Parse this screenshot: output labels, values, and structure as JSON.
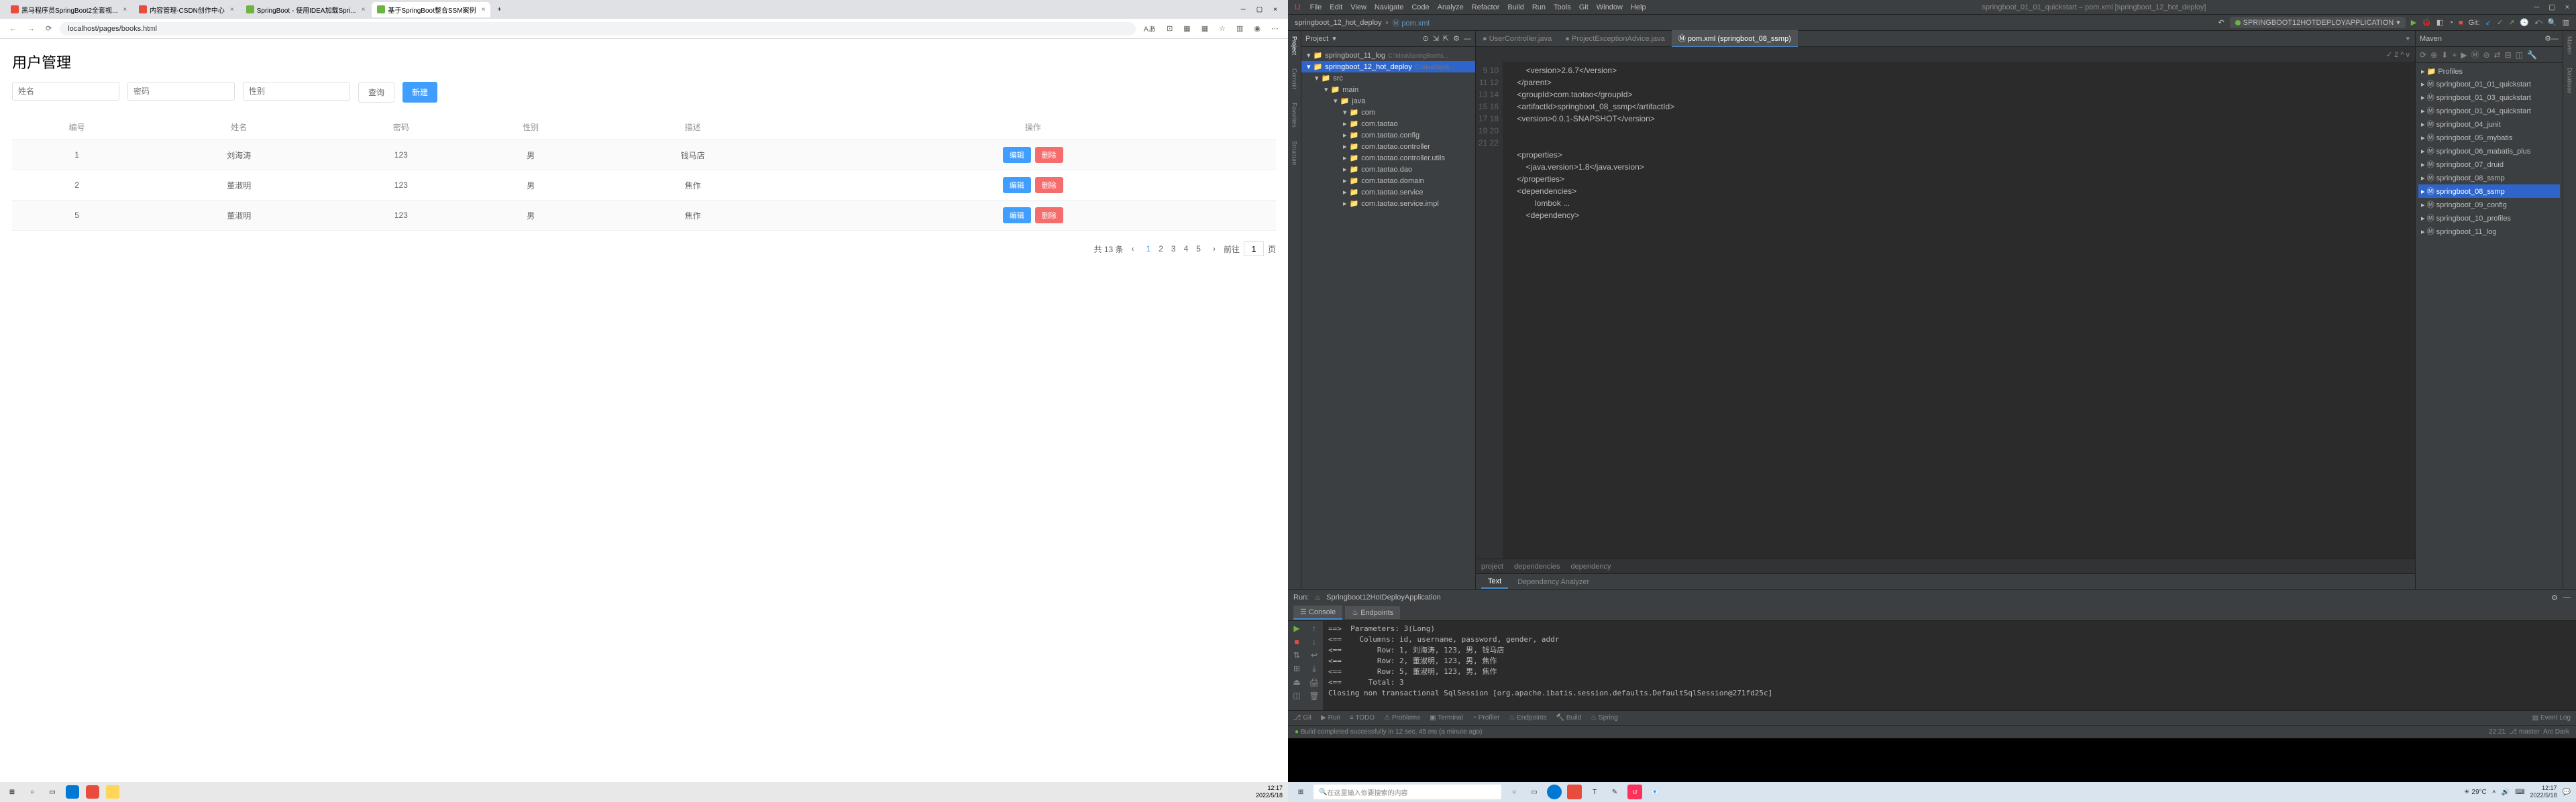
{
  "browser": {
    "tabs": [
      "黑马程序员SpringBoot2全套视...",
      "内容管理-CSDN创作中心",
      "SpringBoot - 使用IDEA加载Spri...",
      "基于SpringBoot整合SSM案例"
    ],
    "url": "localhost/pages/books.html"
  },
  "page": {
    "title": "用户管理",
    "placeholders": {
      "name": "姓名",
      "pwd": "密码",
      "gender": "性别"
    },
    "buttons": {
      "query": "查询",
      "create": "新建"
    },
    "headers": {
      "id": "编号",
      "name": "姓名",
      "pwd": "密码",
      "gender": "性别",
      "addr": "描述",
      "ops": "操作"
    },
    "rows": [
      {
        "id": "1",
        "name": "刘海涛",
        "pwd": "123",
        "gender": "男",
        "addr": "钱马店"
      },
      {
        "id": "2",
        "name": "董淑明",
        "pwd": "123",
        "gender": "男",
        "addr": "焦作"
      },
      {
        "id": "5",
        "name": "董淑明",
        "pwd": "123",
        "gender": "男",
        "addr": "焦作"
      }
    ],
    "ops": {
      "edit": "编辑",
      "del": "删除"
    },
    "pagination": {
      "total": "共 13 条",
      "pages": [
        "1",
        "2",
        "3",
        "4",
        "5"
      ],
      "goto": "前往",
      "page": "1",
      "unit": "页"
    }
  },
  "leftTaskbar": {
    "time": "12:17",
    "date": "2022/5/18"
  },
  "ide": {
    "menu": [
      "File",
      "Edit",
      "View",
      "Navigate",
      "Code",
      "Analyze",
      "Refactor",
      "Build",
      "Run",
      "Tools",
      "Git",
      "Window",
      "Help"
    ],
    "winTitle": "springboot_01_01_quickstart – pom.xml [springboot_12_hot_deploy]",
    "breadcrumb": [
      "springboot_12_hot_deploy",
      "pom.xml"
    ],
    "runConfig": "SPRINGBOOT12HOTDEPLOYAPPLICATION",
    "gitLabel": "Git:",
    "project": {
      "header": "Project",
      "roots": [
        {
          "name": "springboot_11_log",
          "path": "C:\\idea\\SpringBoot\\s..."
        },
        {
          "name": "springboot_12_hot_deploy",
          "path": "C:\\idea\\Sprin..."
        }
      ],
      "tree": [
        "src",
        "main",
        "java",
        "com",
        "com.taotao",
        "com.taotao.config",
        "com.taotao.controller",
        "com.taotao.controller.utils",
        "com.taotao.dao",
        "com.taotao.domain",
        "com.taotao.service",
        "com.taotao.service.impl"
      ]
    },
    "editorTabs": [
      "UserController.java",
      "ProjectExceptionAdvice.java",
      "pom.xml (springboot_08_ssmp)"
    ],
    "toolbarStatus": "✓ 2 ^ v",
    "gutter": [
      "9",
      "10",
      "11",
      "12",
      "13",
      "14",
      "15",
      "16",
      "17",
      "18",
      "19",
      "20",
      "21",
      "22"
    ],
    "code": [
      "        <version>2.6.7</version>",
      "    </parent>",
      "    <groupId>com.taotao</groupId>",
      "    <artifactId>springboot_08_ssmp</artifactId>",
      "    <version>0.0.1-SNAPSHOT</version>",
      "",
      "",
      "    <properties>",
      "        <java.version>1.8</java.version>",
      "    </properties>",
      "    <dependencies>",
      "            lombok ...",
      "        <dependency>"
    ],
    "bcTabs": [
      "project",
      "dependencies",
      "dependency"
    ],
    "subTabs": [
      "Text",
      "Dependency Analyzer"
    ],
    "maven": {
      "header": "Maven",
      "items": [
        "Profiles",
        "springboot_01_01_quickstart",
        "springboot_01_03_quickstart",
        "springboot_01_04_quickstart",
        "springboot_04_junit",
        "springboot_05_mybatis",
        "springboot_06_mabatis_plus",
        "springboot_07_druid",
        "springboot_08_ssmp",
        "springboot_08_ssmp",
        "springboot_09_config",
        "springboot_10_profiles",
        "springboot_11_log"
      ]
    },
    "run": {
      "header": "Run:",
      "app": "Springboot12HotDeployApplication",
      "tabs": [
        "Console",
        "Endpoints"
      ],
      "lines": [
        "==>  Parameters: 3(Long)",
        "<==    Columns: id, username, password, gender, addr",
        "<==        Row: 1, 刘海涛, 123, 男, 钱马店",
        "<==        Row: 2, 董淑明, 123, 男, 焦作",
        "<==        Row: 5, 董淑明, 123, 男, 焦作",
        "<==      Total: 3",
        "Closing non transactional SqlSession [org.apache.ibatis.session.defaults.DefaultSqlSession@271fd25c]"
      ]
    },
    "bottombar": [
      "Git",
      "Run",
      "TODO",
      "Problems",
      "Terminal",
      "Profiler",
      "Endpoints",
      "Build",
      "Spring"
    ],
    "eventLog": "Event Log",
    "buildMsg": "Build completed successfully in 12 sec, 45 ms (a minute ago)",
    "status": {
      "time": "22:21",
      "branch": "master",
      "theme": "Arc Dark"
    }
  },
  "winTaskbar": {
    "search": "在这里输入你要搜索的内容",
    "weather": "29°C",
    "time": "12:17",
    "date": "2022/5/18"
  }
}
